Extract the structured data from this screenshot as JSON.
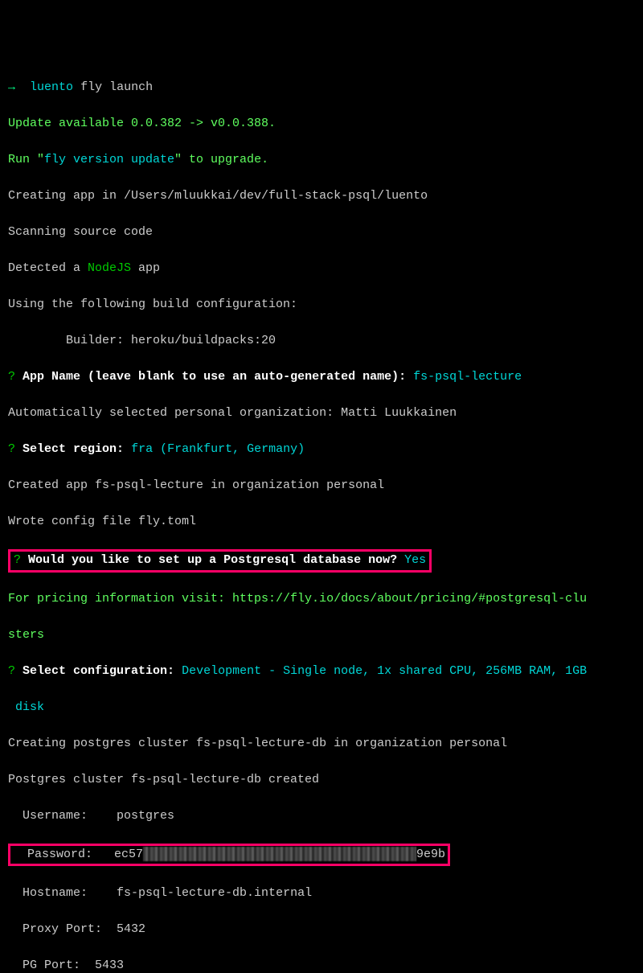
{
  "prompt": {
    "arrow": "→",
    "dir": "luento",
    "cmd": "fly launch"
  },
  "lines": {
    "update": "Update available 0.0.382 -> v0.0.388.",
    "run_upgrade_1": "Run \"",
    "run_upgrade_cmd": "fly version update",
    "run_upgrade_2": "\" to upgrade.",
    "creating_app": "Creating app in /Users/mluukkai/dev/full-stack-psql/luento",
    "scanning": "Scanning source code",
    "detected_1": "Detected a ",
    "detected_type": "NodeJS",
    "detected_2": " app",
    "using_config": "Using the following build configuration:",
    "builder_line": "        Builder: heroku/buildpacks:20"
  },
  "q1": {
    "mark": "?",
    "label": "App Name (leave blank to use an auto-generated name):",
    "answer": "fs-psql-lecture"
  },
  "org": "Automatically selected personal organization: Matti Luukkainen",
  "q2": {
    "mark": "?",
    "label": "Select region:",
    "answer": "fra (Frankfurt, Germany)"
  },
  "created": "Created app fs-psql-lecture in organization personal",
  "wrote": "Wrote config file fly.toml",
  "q3": {
    "mark": "?",
    "label": "Would you like to set up a Postgresql database now?",
    "answer": "Yes"
  },
  "pricing_1": "For pricing information visit: https://fly.io/docs/about/pricing/#postgresql-clu",
  "pricing_2": "sters",
  "q4": {
    "mark": "?",
    "label": "Select configuration:",
    "answer_line1": "Development - Single node, 1x shared CPU, 256MB RAM, 1GB",
    "answer_line2": " disk"
  },
  "creating_pg": "Creating postgres cluster fs-psql-lecture-db in organization personal",
  "pg_created": "Postgres cluster fs-psql-lecture-db created",
  "creds": {
    "username_label": "  Username:    ",
    "username": "postgres",
    "password_label": "  Password:   ",
    "password_prefix": "ec57",
    "password_suffix": "9e9b",
    "hostname_label": "  Hostname:    ",
    "hostname": "fs-psql-lecture-db.internal",
    "proxy_label": "  Proxy Port:  ",
    "proxy_port": "5432",
    "pg_label": "  PG Port:  ",
    "pg_port": "5433"
  }
}
